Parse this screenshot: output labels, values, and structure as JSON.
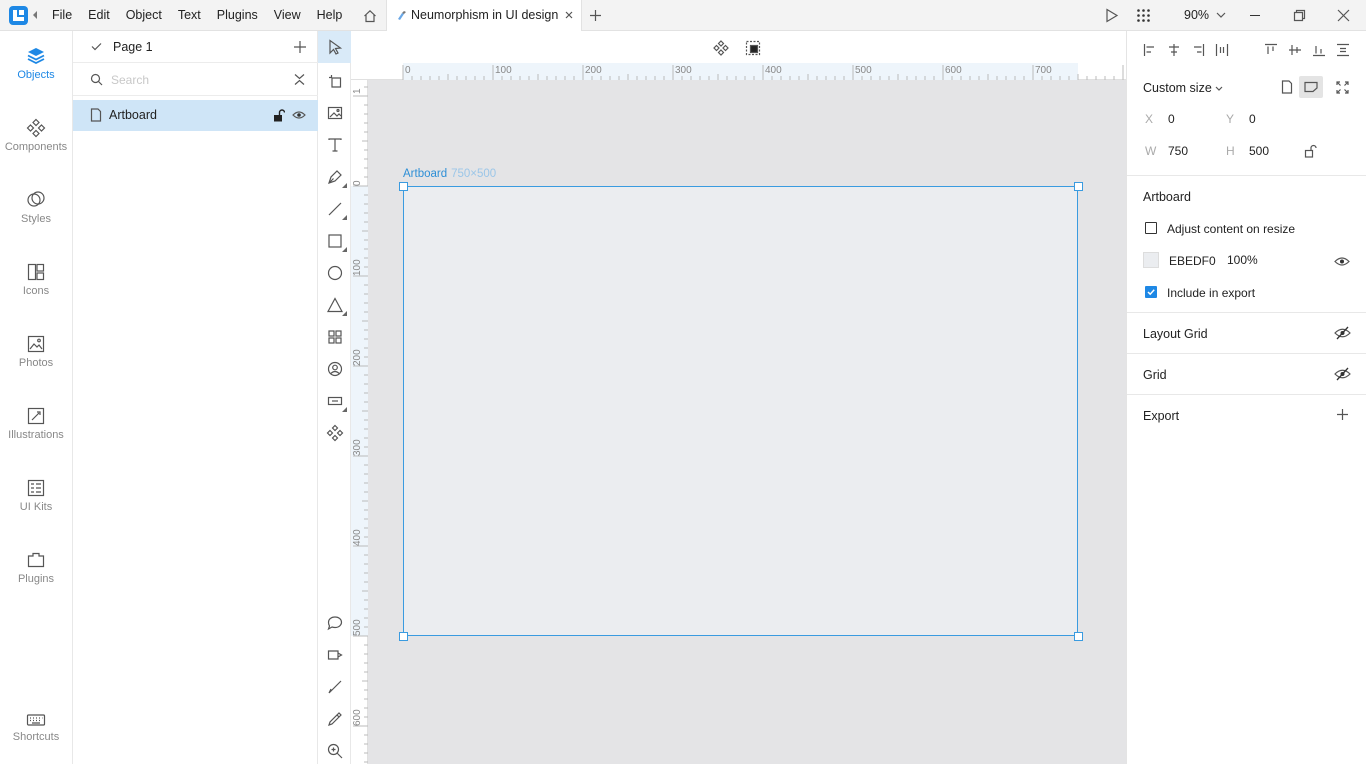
{
  "menu": [
    "File",
    "Edit",
    "Object",
    "Text",
    "Plugins",
    "View",
    "Help"
  ],
  "tab": {
    "title": "Neumorphism in UI design"
  },
  "zoom": "90%",
  "left_nav": [
    {
      "label": "Objects",
      "icon": "objects-icon",
      "active": true
    },
    {
      "label": "Components",
      "icon": "components-icon"
    },
    {
      "label": "Styles",
      "icon": "styles-icon"
    },
    {
      "label": "Icons",
      "icon": "icons-icon"
    },
    {
      "label": "Photos",
      "icon": "photos-icon"
    },
    {
      "label": "Illustrations",
      "icon": "illustrations-icon"
    },
    {
      "label": "UI Kits",
      "icon": "ui-kits-icon"
    },
    {
      "label": "Plugins",
      "icon": "plugins-icon"
    },
    {
      "label": "Shortcuts",
      "icon": "keyboard-icon"
    }
  ],
  "layers": {
    "page_name": "Page 1",
    "search_placeholder": "Search",
    "items": [
      {
        "name": "Artboard"
      }
    ]
  },
  "ruler": {
    "h_ticks": [
      "0",
      "100",
      "200",
      "300",
      "400",
      "500",
      "600",
      "700"
    ],
    "v_ticks": [
      "1",
      "0",
      "100",
      "200",
      "300",
      "400",
      "500",
      "600"
    ]
  },
  "artboard": {
    "label": "Artboard",
    "size": "750×500",
    "fill": "#EBEDF0",
    "accent": "#1E88E5"
  },
  "props": {
    "size_preset": "Custom size",
    "x_label": "X",
    "x": "0",
    "y_label": "Y",
    "y": "0",
    "w_label": "W",
    "w": "750",
    "h_label": "H",
    "h": "500",
    "artboard_section": "Artboard",
    "adjust_label": "Adjust content on resize",
    "adjust_checked": false,
    "fill_hex": "EBEDF0",
    "fill_opacity": "100%",
    "include_label": "Include in export",
    "include_checked": true,
    "layout_grid": "Layout Grid",
    "grid": "Grid",
    "export": "Export"
  }
}
